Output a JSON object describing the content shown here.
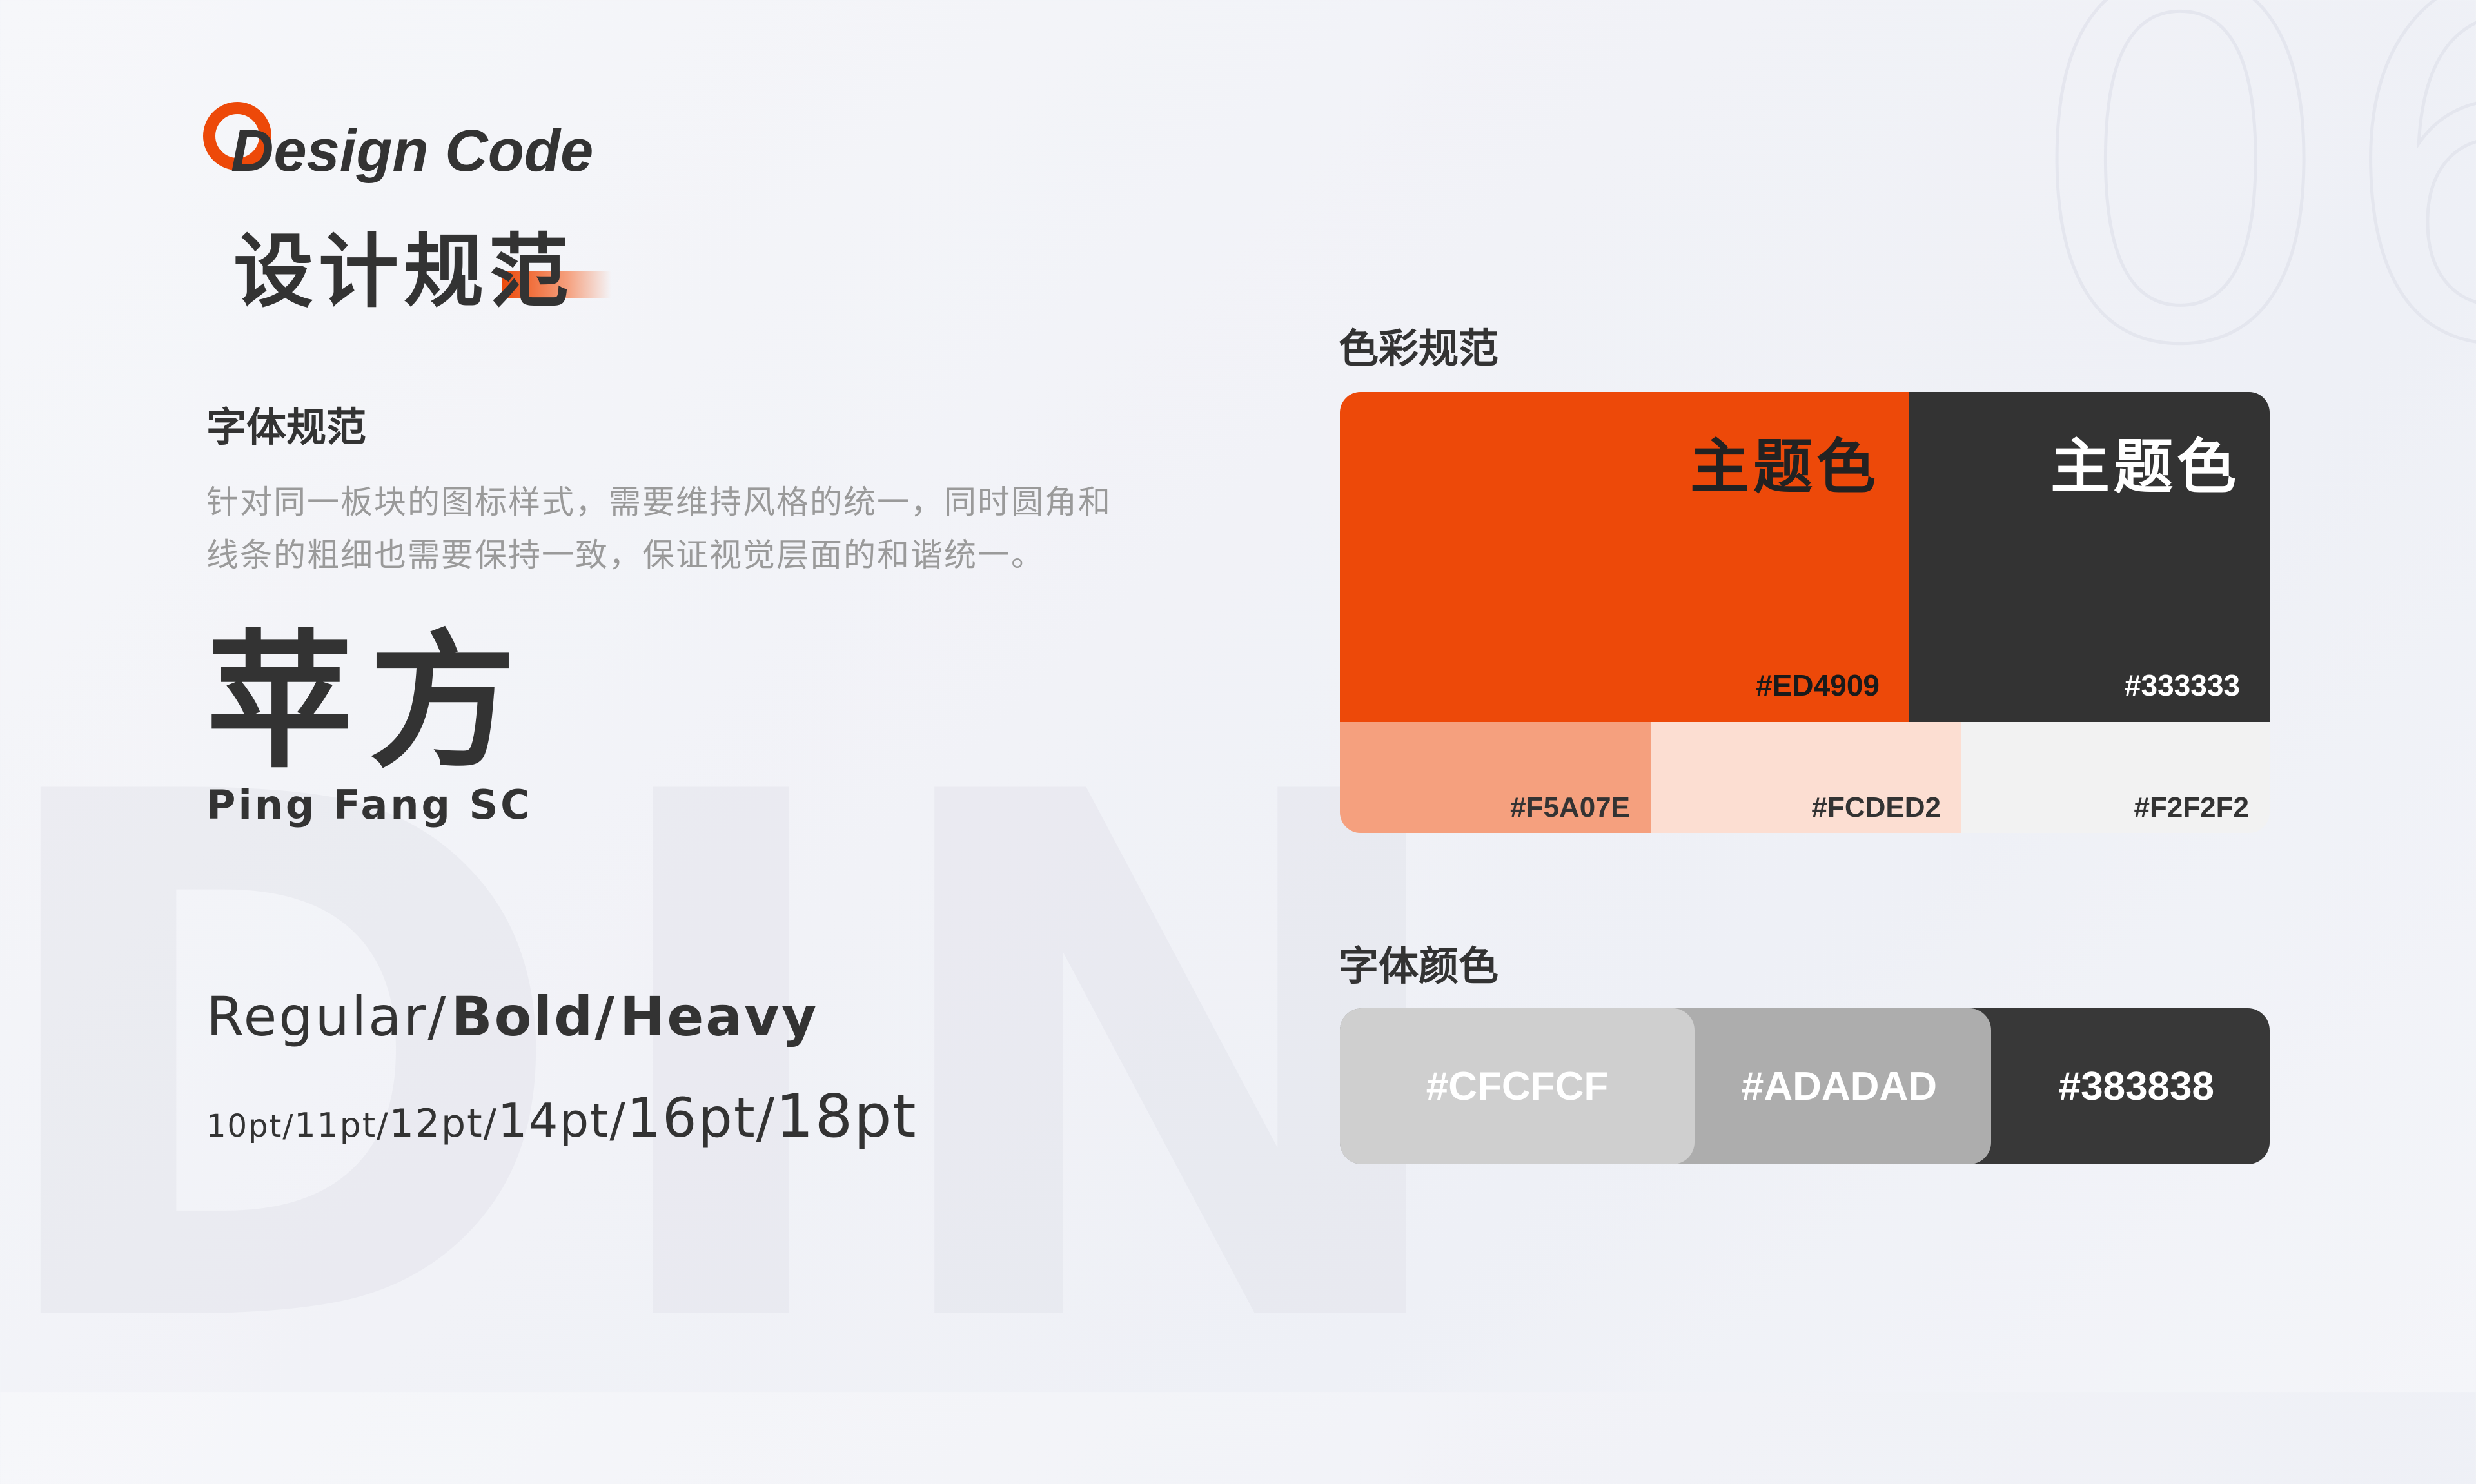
{
  "background": {
    "din": "DIN",
    "number": "06"
  },
  "header": {
    "title_en": "Design Code",
    "title_cn": "设计规范",
    "accent_color": "#ED4909"
  },
  "font_spec": {
    "title": "字体规范",
    "description_line1": "针对同一板块的图标样式，需要维持风格的统一，同时圆角和",
    "description_line2": "线条的粗细也需要保持一致，保证视觉层面的和谐统一。",
    "font_name_cn": "苹方",
    "font_name_en": "Ping Fang SC",
    "weights": {
      "regular": "Regular/",
      "bold": "Bold/",
      "heavy": "Heavy"
    },
    "sizes": [
      "10pt/",
      "11pt/",
      "12pt/",
      "14pt/",
      "16pt/",
      "18pt"
    ]
  },
  "color_spec": {
    "title": "色彩规范",
    "primary": {
      "name": "主题色",
      "hex": "#ED4909"
    },
    "secondary": {
      "name": "主题色",
      "hex": "#333333"
    },
    "tints": [
      {
        "hex": "#F5A07E"
      },
      {
        "hex": "#FCDED2"
      },
      {
        "hex": "#F2F2F2"
      }
    ]
  },
  "text_color_spec": {
    "title": "字体颜色",
    "colors": [
      {
        "hex": "#CFCFCF"
      },
      {
        "hex": "#ADADAD"
      },
      {
        "hex": "#383838"
      }
    ]
  }
}
